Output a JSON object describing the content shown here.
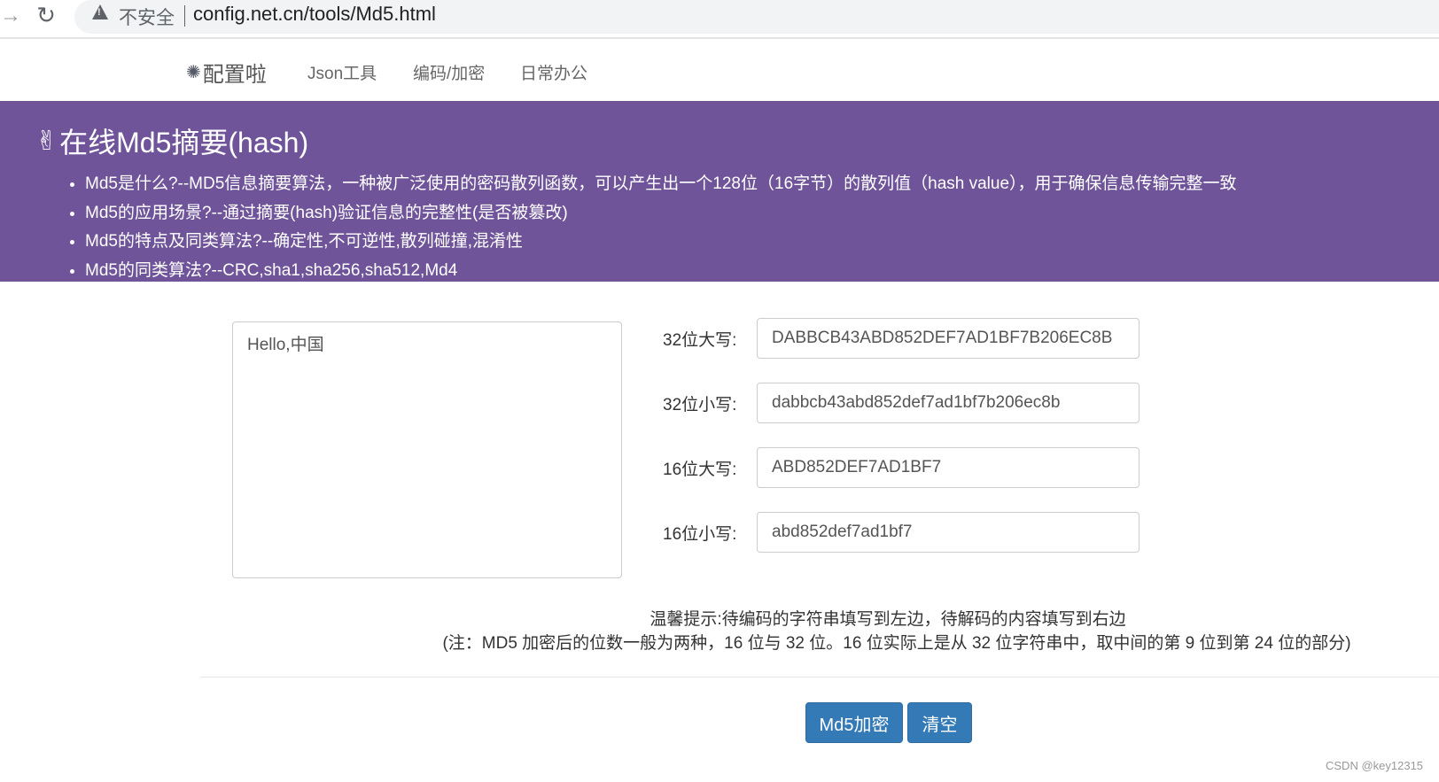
{
  "browser": {
    "security_label": "不安全",
    "url": "config.net.cn/tools/Md5.html"
  },
  "nav": {
    "brand": "配置啦",
    "links": [
      "Json工具",
      "编码/加密",
      "日常办公"
    ]
  },
  "banner": {
    "title": "在线Md5摘要(hash)",
    "items": [
      "Md5是什么?--MD5信息摘要算法，一种被广泛使用的密码散列函数，可以产生出一个128位（16字节）的散列值（hash value），用于确保信息传输完整一致",
      "Md5的应用场景?--通过摘要(hash)验证信息的完整性(是否被篡改)",
      "Md5的特点及同类算法?--确定性,不可逆性,散列碰撞,混淆性",
      "Md5的同类算法?--CRC,sha1,sha256,sha512,Md4"
    ]
  },
  "source_text": "Hello,中国",
  "results": [
    {
      "label": "32位大写:",
      "value": "DABBCB43ABD852DEF7AD1BF7B206EC8B"
    },
    {
      "label": "32位小写:",
      "value": "dabbcb43abd852def7ad1bf7b206ec8b"
    },
    {
      "label": "16位大写:",
      "value": "ABD852DEF7AD1BF7"
    },
    {
      "label": "16位小写:",
      "value": "abd852def7ad1bf7"
    }
  ],
  "tips": {
    "line1": "温馨提示:待编码的字符串填写到左边，待解码的内容填写到右边",
    "line2": "(注：MD5 加密后的位数一般为两种，16 位与 32 位。16 位实际上是从 32 位字符串中，取中间的第 9 位到第 24 位的部分)"
  },
  "buttons": {
    "encrypt": "Md5加密",
    "clear": "清空"
  },
  "watermark": "CSDN @key12315",
  "colors": {
    "banner": "#6f5499",
    "button": "#337ab7"
  }
}
